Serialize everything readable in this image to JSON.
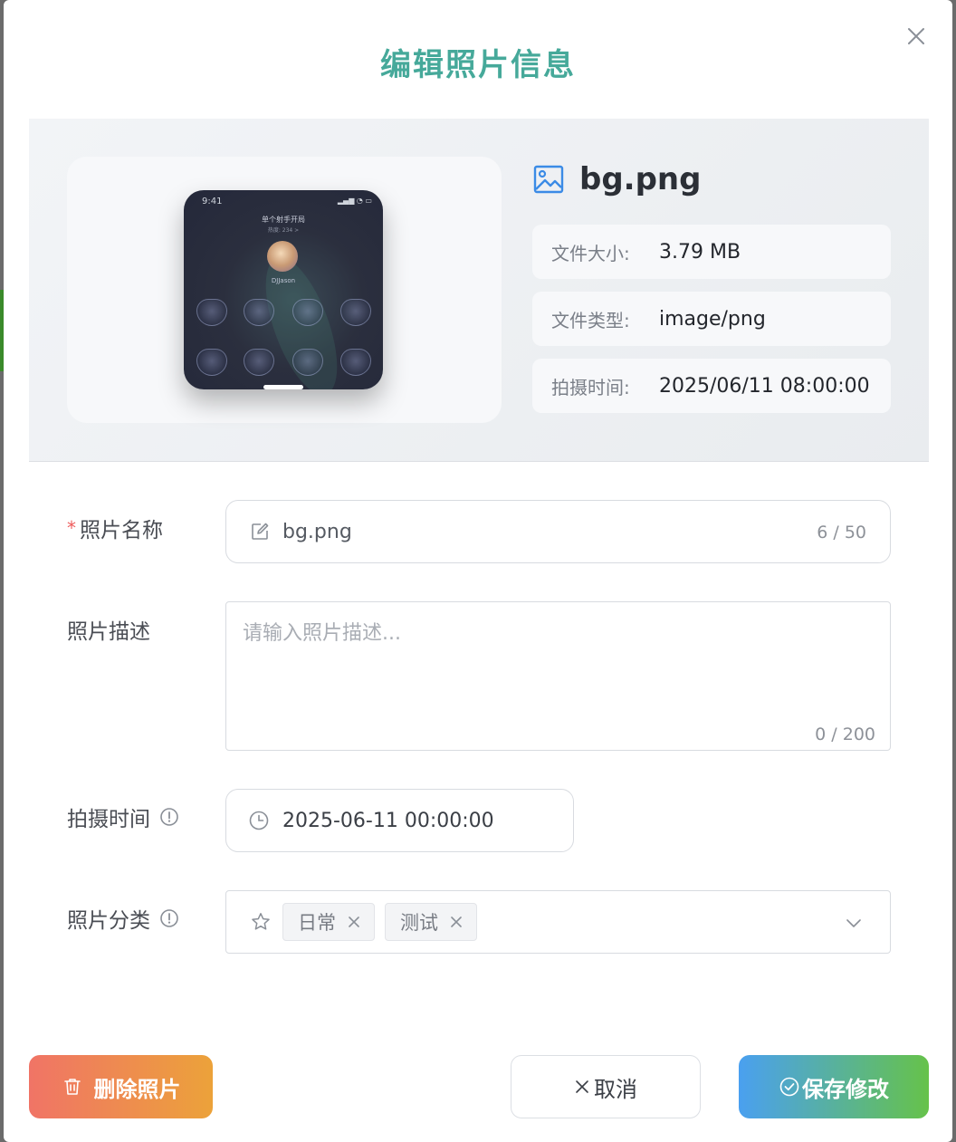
{
  "dialog": {
    "title": "编辑照片信息"
  },
  "preview": {
    "file_name": "bg.png",
    "thumbnail": {
      "time": "9:41",
      "header": "单个射手开局",
      "subheader": "热度: 234 >",
      "user_name": "DJJason"
    },
    "meta": [
      {
        "label": "文件大小:",
        "value": "3.79 MB"
      },
      {
        "label": "文件类型:",
        "value": "image/png"
      },
      {
        "label": "拍摄时间:",
        "value": "2025/06/11 08:00:00"
      }
    ]
  },
  "form": {
    "name": {
      "label": "照片名称",
      "required_mark": "*",
      "value": "bg.png",
      "counter": "6 / 50"
    },
    "description": {
      "label": "照片描述",
      "placeholder": "请输入照片描述...",
      "counter": "0 / 200"
    },
    "taken_time": {
      "label": "拍摄时间",
      "value": "2025-06-11 00:00:00"
    },
    "category": {
      "label": "照片分类",
      "tags": [
        "日常",
        "测试"
      ]
    }
  },
  "footer": {
    "delete_label": "删除照片",
    "cancel_label": "取消",
    "save_label": "保存修改"
  },
  "colors": {
    "title": "#46a99a",
    "delete_gradient": [
      "#f07466",
      "#eca23a"
    ],
    "save_gradient": [
      "#4aa0f0",
      "#66c24a"
    ],
    "required": "#ee5c5c",
    "icon_blue": "#3b8be6"
  }
}
